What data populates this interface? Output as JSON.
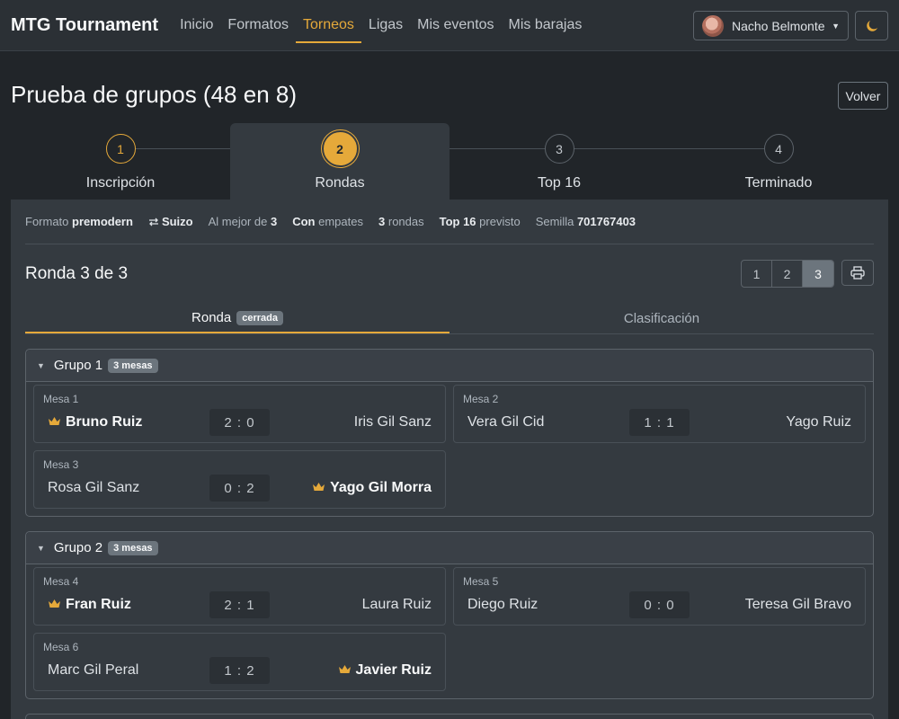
{
  "brand": "MTG Tournament",
  "nav": [
    "Inicio",
    "Formatos",
    "Torneos",
    "Ligas",
    "Mis eventos",
    "Mis barajas"
  ],
  "nav_active": "Torneos",
  "user": {
    "name": "Nacho Belmonte"
  },
  "theme_icon": "moon-icon",
  "page": {
    "title": "Prueba de grupos (48 en 8)",
    "back": "Volver"
  },
  "steps": [
    {
      "num": "1",
      "label": "Inscripción",
      "state": "done"
    },
    {
      "num": "2",
      "label": "Rondas",
      "state": "active"
    },
    {
      "num": "3",
      "label": "Top 16",
      "state": "pending"
    },
    {
      "num": "4",
      "label": "Terminado",
      "state": "pending"
    }
  ],
  "info": {
    "formato_label": "Formato",
    "formato": "premodern",
    "sistema": "Suizo",
    "mejor_de_label": "Al mejor de",
    "mejor_de": "3",
    "con": "Con",
    "empates": "empates",
    "rondas_num": "3",
    "rondas_label": "rondas",
    "top_label": "Top 16",
    "previsto": "previsto",
    "semilla_label": "Semilla",
    "semilla": "701767403"
  },
  "round": {
    "title": "Ronda 3 de 3",
    "pages": [
      "1",
      "2",
      "3"
    ],
    "active_page": "3"
  },
  "tabs": {
    "ronda": "Ronda",
    "ronda_badge": "cerrada",
    "clasificacion": "Clasificación"
  },
  "groups": [
    {
      "name": "Grupo 1",
      "badge": "3 mesas",
      "matches": [
        {
          "mesa": "Mesa 1",
          "p1": "Bruno Ruiz",
          "score": "2 : 0",
          "p2": "Iris Gil Sanz",
          "winner": 1
        },
        {
          "mesa": "Mesa 2",
          "p1": "Vera Gil Cid",
          "score": "1 : 1",
          "p2": "Yago Ruiz",
          "winner": 0
        },
        {
          "mesa": "Mesa 3",
          "p1": "Rosa Gil Sanz",
          "score": "0 : 2",
          "p2": "Yago Gil Morra",
          "winner": 2
        }
      ]
    },
    {
      "name": "Grupo 2",
      "badge": "3 mesas",
      "matches": [
        {
          "mesa": "Mesa 4",
          "p1": "Fran Ruiz",
          "score": "2 : 1",
          "p2": "Laura Ruiz",
          "winner": 1
        },
        {
          "mesa": "Mesa 5",
          "p1": "Diego Ruiz",
          "score": "0 : 0",
          "p2": "Teresa Gil Bravo",
          "winner": 0
        },
        {
          "mesa": "Mesa 6",
          "p1": "Marc Gil Peral",
          "score": "1 : 2",
          "p2": "Javier Ruiz",
          "winner": 2
        }
      ]
    }
  ],
  "colors": {
    "accent": "#e5a93a",
    "bg": "#212529",
    "panel": "#343a40"
  }
}
